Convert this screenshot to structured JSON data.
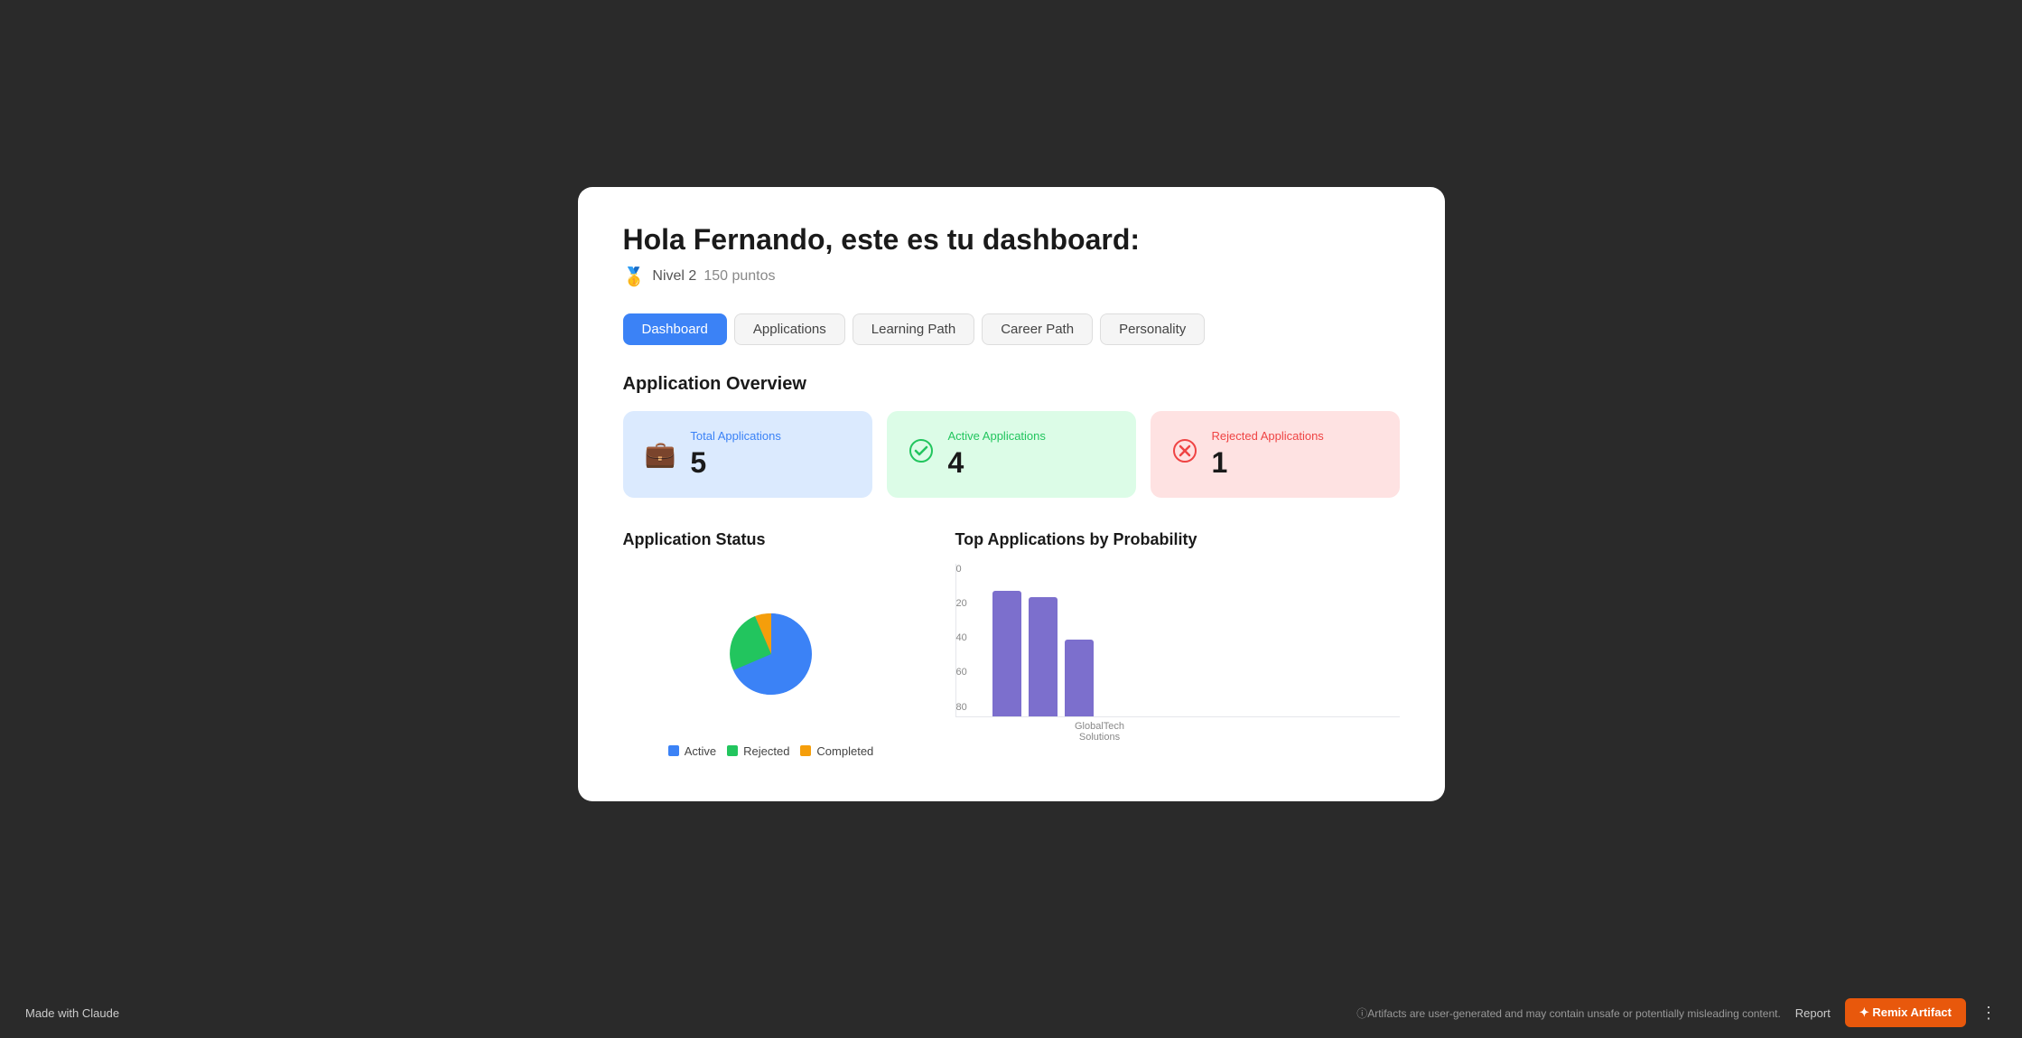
{
  "header": {
    "greeting": "Hola Fernando, este es tu dashboard:",
    "level_icon": "🥇",
    "level_label": "Nivel 2",
    "points": "150 puntos"
  },
  "tabs": [
    {
      "id": "dashboard",
      "label": "Dashboard",
      "active": true
    },
    {
      "id": "applications",
      "label": "Applications",
      "active": false
    },
    {
      "id": "learning-path",
      "label": "Learning Path",
      "active": false
    },
    {
      "id": "career-path",
      "label": "Career Path",
      "active": false
    },
    {
      "id": "personality",
      "label": "Personality",
      "active": false
    }
  ],
  "overview": {
    "title": "Application Overview",
    "cards": [
      {
        "id": "total",
        "label": "Total Applications",
        "value": "5",
        "theme": "blue",
        "icon": "💼"
      },
      {
        "id": "active",
        "label": "Active Applications",
        "value": "4",
        "theme": "green",
        "icon": "✅"
      },
      {
        "id": "rejected",
        "label": "Rejected Applications",
        "value": "1",
        "theme": "red",
        "icon": "❌"
      }
    ]
  },
  "status_section": {
    "title": "Application Status",
    "legend": [
      {
        "id": "active",
        "label": "Active",
        "color": "#3b82f6"
      },
      {
        "id": "rejected",
        "label": "Rejected",
        "color": "#22c55e"
      },
      {
        "id": "completed",
        "label": "Completed",
        "color": "#f59e0b"
      }
    ]
  },
  "probability_section": {
    "title": "Top Applications by Probability",
    "y_labels": [
      "0",
      "20",
      "40",
      "60",
      "80"
    ],
    "bars": [
      {
        "company": "GlobalTech",
        "value": 82,
        "height_pct": 82
      },
      {
        "company": "Solutions",
        "value": 78,
        "height_pct": 78
      },
      {
        "company": "",
        "value": 50,
        "height_pct": 50
      }
    ],
    "x_label": "GlobalTech Solutions",
    "bar_color": "#7c6fcd",
    "max_value": 100
  },
  "footer": {
    "made_with": "Made with Claude",
    "info": "ⓘArtifacts are user-generated and may contain unsafe or potentially misleading content.",
    "report_label": "Report",
    "remix_label": "✦ Remix Artifact"
  }
}
